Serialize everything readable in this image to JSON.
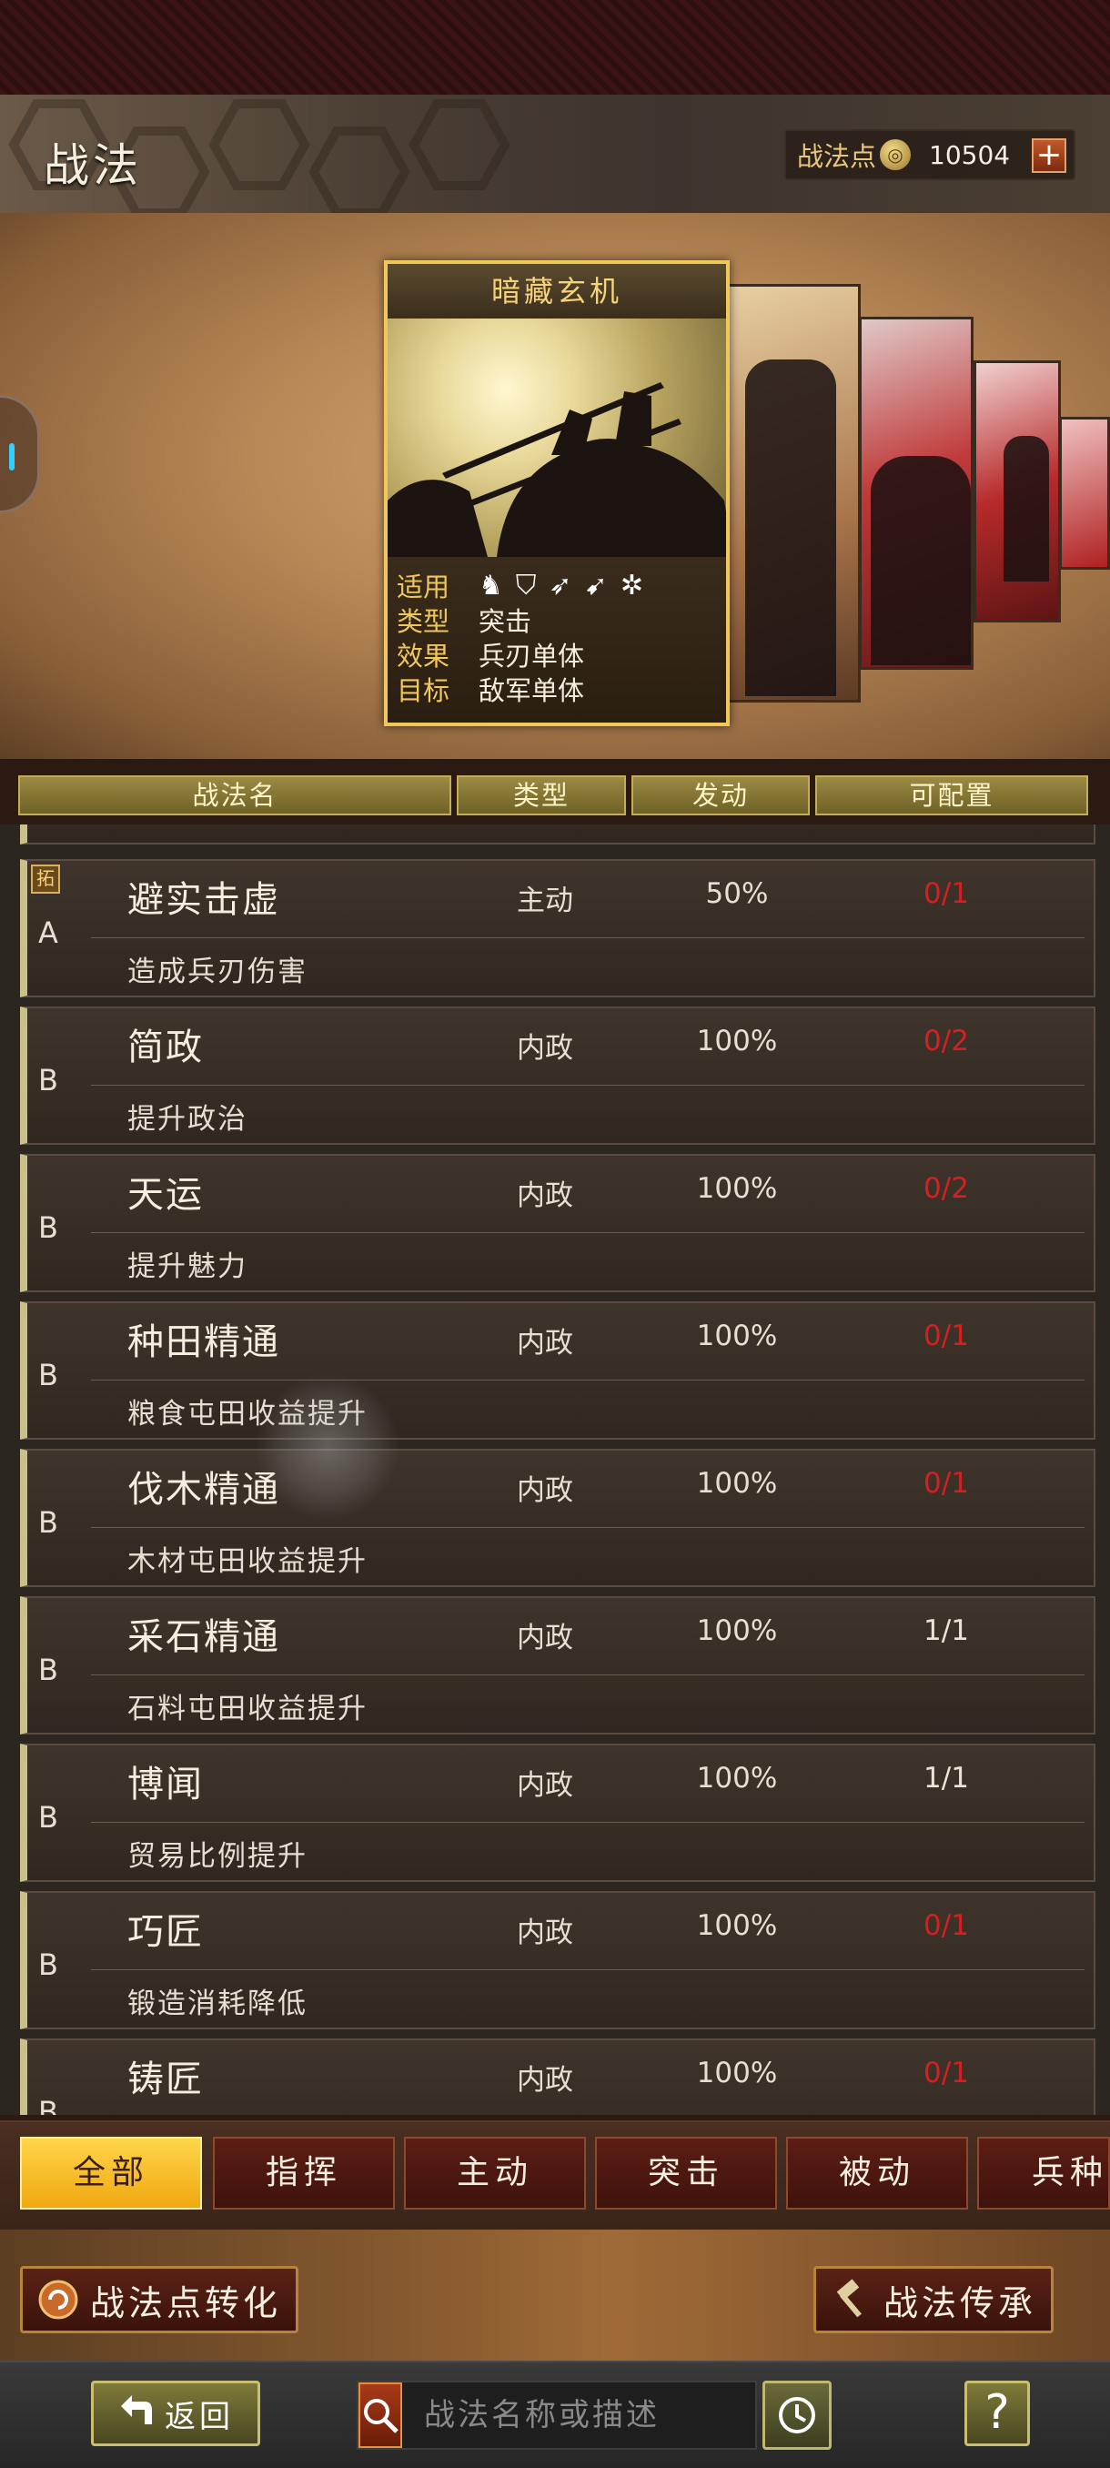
{
  "header": {
    "title": "战法",
    "points_label": "战法点",
    "points_value": "10504",
    "points_icon": "coin-icon",
    "add_label": "+"
  },
  "featured": {
    "name": "暗藏玄机",
    "rows": [
      {
        "key": "适用",
        "value": ""
      },
      {
        "key": "类型",
        "value": "突击"
      },
      {
        "key": "效果",
        "value": "兵刃单体"
      },
      {
        "key": "目标",
        "value": "敌军单体"
      }
    ],
    "troop_icons": [
      "cavalry-icon",
      "shield-icon",
      "bow-icon",
      "spear-icon",
      "wheel-icon"
    ]
  },
  "table": {
    "columns": [
      "战法名",
      "类型",
      "发动",
      "可配置"
    ],
    "rows": [
      {
        "badge": "拓",
        "grade": "A",
        "name": "避实击虚",
        "type": "主动",
        "rate": "50%",
        "available": "0/1",
        "available_color": "red",
        "desc": "造成兵刃伤害"
      },
      {
        "badge": "",
        "grade": "B",
        "name": "简政",
        "type": "内政",
        "rate": "100%",
        "available": "0/2",
        "available_color": "red",
        "desc": "提升政治"
      },
      {
        "badge": "",
        "grade": "B",
        "name": "天运",
        "type": "内政",
        "rate": "100%",
        "available": "0/2",
        "available_color": "red",
        "desc": "提升魅力"
      },
      {
        "badge": "",
        "grade": "B",
        "name": "种田精通",
        "type": "内政",
        "rate": "100%",
        "available": "0/1",
        "available_color": "red",
        "desc": "粮食屯田收益提升"
      },
      {
        "badge": "",
        "grade": "B",
        "name": "伐木精通",
        "type": "内政",
        "rate": "100%",
        "available": "0/1",
        "available_color": "red",
        "desc": "木材屯田收益提升"
      },
      {
        "badge": "",
        "grade": "B",
        "name": "采石精通",
        "type": "内政",
        "rate": "100%",
        "available": "1/1",
        "available_color": "white",
        "desc": "石料屯田收益提升"
      },
      {
        "badge": "",
        "grade": "B",
        "name": "博闻",
        "type": "内政",
        "rate": "100%",
        "available": "1/1",
        "available_color": "white",
        "desc": "贸易比例提升"
      },
      {
        "badge": "",
        "grade": "B",
        "name": "巧匠",
        "type": "内政",
        "rate": "100%",
        "available": "0/1",
        "available_color": "red",
        "desc": "锻造消耗降低"
      },
      {
        "badge": "",
        "grade": "B",
        "name": "铸匠",
        "type": "内政",
        "rate": "100%",
        "available": "0/1",
        "available_color": "red",
        "desc": ""
      }
    ]
  },
  "tabs": [
    "全部",
    "指挥",
    "主动",
    "突击",
    "被动",
    "兵种"
  ],
  "active_tab": "全部",
  "actions": {
    "convert_label": "战法点转化",
    "inherit_label": "战法传承"
  },
  "footer": {
    "back_label": "返回",
    "search_placeholder": "战法名称或描述",
    "help_label": "?"
  },
  "colors": {
    "accent_gold": "#f0c85a",
    "active_tab": "#ffd54a",
    "unavailable_red": "#d42020"
  }
}
